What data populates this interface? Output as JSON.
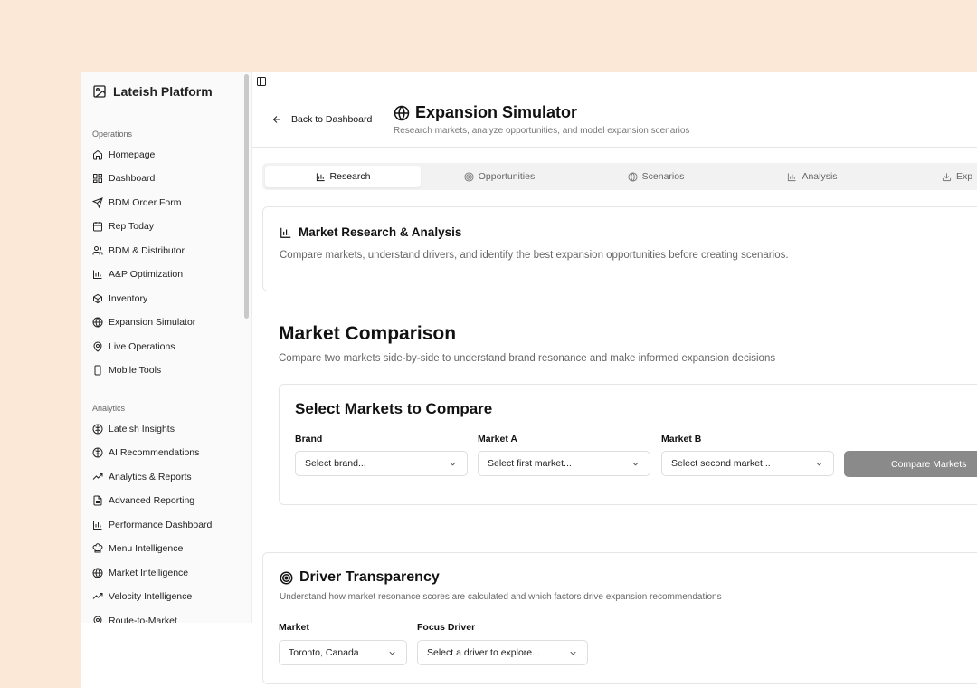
{
  "sidebar": {
    "brand": "Lateish Platform",
    "groups": [
      {
        "label": "Operations"
      },
      {
        "label": "Analytics"
      }
    ],
    "items": [
      {
        "label": "Homepage",
        "icon": "home-icon"
      },
      {
        "label": "Dashboard",
        "icon": "dashboard-icon"
      },
      {
        "label": "BDM Order Form",
        "icon": "send-icon"
      },
      {
        "label": "Rep Today",
        "icon": "calendar-icon"
      },
      {
        "label": "BDM & Distributor",
        "icon": "users-icon"
      },
      {
        "label": "A&P Optimization",
        "icon": "bar-chart-icon"
      },
      {
        "label": "Inventory",
        "icon": "package-icon"
      },
      {
        "label": "Expansion Simulator",
        "icon": "globe-icon"
      },
      {
        "label": "Live Operations",
        "icon": "map-pin-icon"
      },
      {
        "label": "Mobile Tools",
        "icon": "smartphone-icon"
      },
      {
        "label": "Lateish Insights",
        "icon": "brain-icon"
      },
      {
        "label": "AI Recommendations",
        "icon": "brain-icon"
      },
      {
        "label": "Analytics & Reports",
        "icon": "trending-up-icon"
      },
      {
        "label": "Advanced Reporting",
        "icon": "file-text-icon"
      },
      {
        "label": "Performance Dashboard",
        "icon": "bar-chart-icon"
      },
      {
        "label": "Menu Intelligence",
        "icon": "chef-hat-icon"
      },
      {
        "label": "Market Intelligence",
        "icon": "globe-icon"
      },
      {
        "label": "Velocity Intelligence",
        "icon": "trending-up-icon"
      },
      {
        "label": "Route-to-Market",
        "icon": "map-pin-icon"
      }
    ]
  },
  "header": {
    "back_label": "Back to Dashboard",
    "title": "Expansion Simulator",
    "subtitle": "Research markets, analyze opportunities, and model expansion scenarios"
  },
  "tabs": [
    {
      "label": "Research",
      "icon": "bar-chart-icon",
      "active": true
    },
    {
      "label": "Opportunities",
      "icon": "target-icon",
      "active": false
    },
    {
      "label": "Scenarios",
      "icon": "globe-icon",
      "active": false
    },
    {
      "label": "Analysis",
      "icon": "bar-chart-icon",
      "active": false
    },
    {
      "label": "Exp",
      "icon": "download-icon",
      "active": false
    }
  ],
  "research_card": {
    "title": "Market Research & Analysis",
    "subtitle": "Compare markets, understand drivers, and identify the best expansion opportunities before creating scenarios."
  },
  "market_comparison": {
    "title": "Market Comparison",
    "subtitle": "Compare two markets side-by-side to understand brand resonance and make informed expansion decisions",
    "select_title": "Select Markets to Compare",
    "brand_label": "Brand",
    "brand_placeholder": "Select brand...",
    "market_a_label": "Market A",
    "market_a_placeholder": "Select first market...",
    "market_b_label": "Market B",
    "market_b_placeholder": "Select second market...",
    "compare_button": "Compare Markets"
  },
  "driver_transparency": {
    "title": "Driver Transparency",
    "subtitle": "Understand how market resonance scores are calculated and which factors drive expansion recommendations",
    "market_label": "Market",
    "market_value": "Toronto, Canada",
    "focus_label": "Focus Driver",
    "focus_placeholder": "Select a driver to explore..."
  },
  "colors": {
    "background": "#fce8d6",
    "button_disabled": "#8a8a8a"
  }
}
